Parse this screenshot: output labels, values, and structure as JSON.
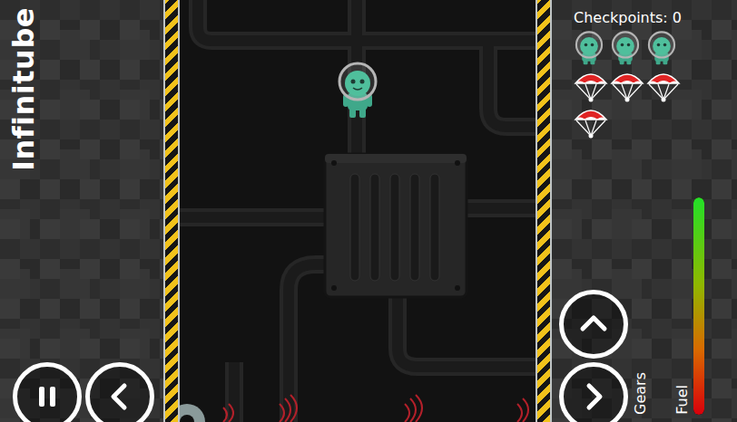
{
  "game": {
    "title": "Infinitube"
  },
  "hud": {
    "checkpoints": "Checkpoints: 0",
    "lives": 3,
    "parachutes": 4,
    "gearsLabel": "Gears",
    "fuelLabel": "Fuel",
    "fuel": {
      "level": 1
    }
  }
}
